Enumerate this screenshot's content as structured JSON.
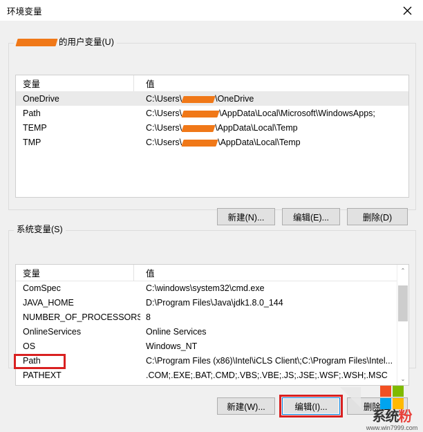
{
  "window": {
    "title": "环境变量",
    "close_label": "✕"
  },
  "user_section": {
    "title_suffix": "的用户变量(U)",
    "columns": {
      "name": "变量",
      "value": "值"
    },
    "rows": [
      {
        "name": "OneDrive",
        "value_prefix": "C:\\Users\\",
        "value_suffix": "\\OneDrive",
        "selected": true
      },
      {
        "name": "Path",
        "value_prefix": "C:\\Users\\",
        "value_suffix": "\\AppData\\Local\\Microsoft\\WindowsApps;",
        "selected": false
      },
      {
        "name": "TEMP",
        "value_prefix": "C:\\Users\\",
        "value_suffix": "\\AppData\\Local\\Temp",
        "selected": false
      },
      {
        "name": "TMP",
        "value_prefix": "C:\\Users\\",
        "value_suffix": "\\AppData\\Local\\Temp",
        "selected": false
      }
    ],
    "buttons": {
      "new": "新建(N)...",
      "edit": "编辑(E)...",
      "delete": "删除(D)"
    }
  },
  "system_section": {
    "title": "系统变量(S)",
    "columns": {
      "name": "变量",
      "value": "值"
    },
    "rows": [
      {
        "name": "ComSpec",
        "value": "C:\\windows\\system32\\cmd.exe"
      },
      {
        "name": "JAVA_HOME",
        "value": "D:\\Program Files\\Java\\jdk1.8.0_144"
      },
      {
        "name": "NUMBER_OF_PROCESSORS",
        "value": "8"
      },
      {
        "name": "OnlineServices",
        "value": "Online Services"
      },
      {
        "name": "OS",
        "value": "Windows_NT"
      },
      {
        "name": "Path",
        "value": "C:\\Program Files (x86)\\Intel\\iCLS Client\\;C:\\Program Files\\Intel..."
      },
      {
        "name": "PATHEXT",
        "value": ".COM;.EXE;.BAT;.CMD;.VBS;.VBE;.JS;.JSE;.WSF;.WSH;.MSC"
      }
    ],
    "buttons": {
      "new": "新建(W)...",
      "edit": "编辑(I)...",
      "delete": "删除(L)"
    },
    "scrollbar": {
      "up_arrow": "⌃",
      "down_arrow": "⌄"
    }
  },
  "annotations": {
    "highlight_color": "#d92020",
    "redaction_color": "#f07818",
    "focus_color": "#0078d7"
  },
  "watermark": {
    "name_part1": "系统",
    "name_part2": "粉",
    "url": "www.win7999.com"
  }
}
